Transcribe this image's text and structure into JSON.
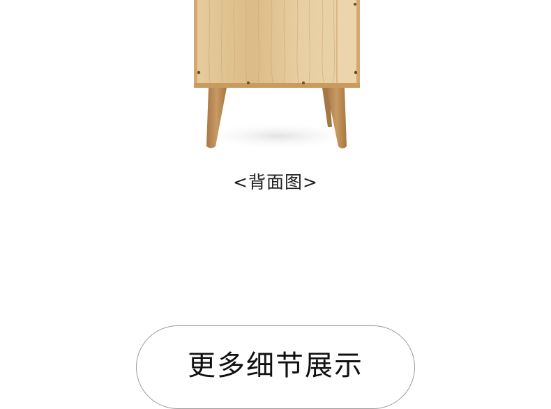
{
  "page": {
    "caption": "<背面图>",
    "section_heading": "更多细节展示"
  },
  "product_image": {
    "subject": "nightstand-back-view",
    "colors": {
      "wood_panel": "#e2c597",
      "wood_grain": "#c9a56f",
      "frame_edge": "#cfa46a",
      "legs": "#b98a56",
      "shadow": "#ececec"
    }
  }
}
